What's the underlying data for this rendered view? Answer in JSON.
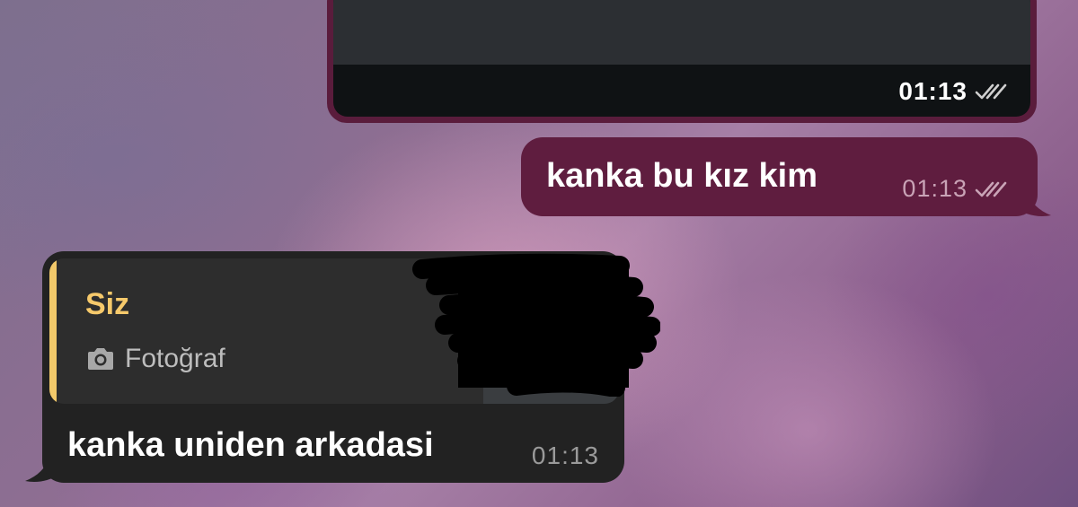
{
  "messages": {
    "outgoing_media": {
      "time": "01:13",
      "status_icon": "double-check-icon"
    },
    "outgoing_text": {
      "text": "kanka bu kız kim",
      "time": "01:13",
      "status_icon": "double-check-icon"
    },
    "incoming_reply": {
      "quote_author": "Siz",
      "quote_icon": "camera-icon",
      "quote_type": "Fotoğraf",
      "text": "kanka uniden arkadasi",
      "time": "01:13"
    }
  },
  "colors": {
    "outgoing_bubble": "#5f1d3f",
    "incoming_bubble": "#222222",
    "quote_accent": "#f2c96a"
  }
}
